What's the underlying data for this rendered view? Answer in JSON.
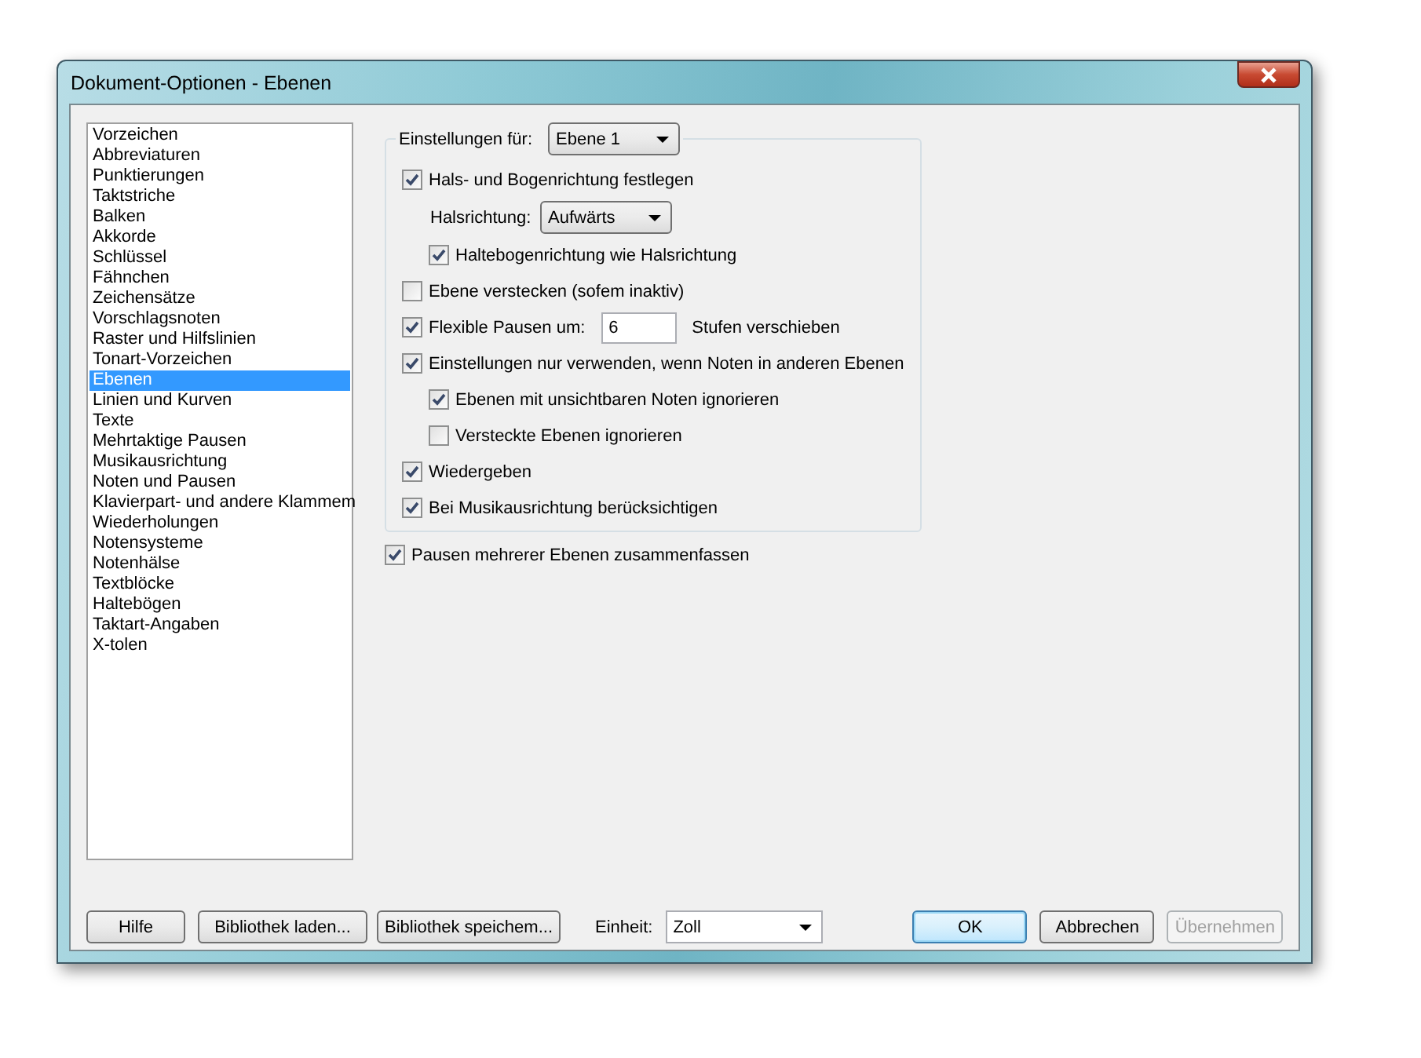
{
  "window": {
    "title": "Dokument-Optionen - Ebenen"
  },
  "categories": [
    {
      "label": "Vorzeichen",
      "selected": false
    },
    {
      "label": "Abbreviaturen",
      "selected": false
    },
    {
      "label": "Punktierungen",
      "selected": false
    },
    {
      "label": "Taktstriche",
      "selected": false
    },
    {
      "label": "Balken",
      "selected": false
    },
    {
      "label": "Akkorde",
      "selected": false
    },
    {
      "label": "Schlüssel",
      "selected": false
    },
    {
      "label": "Fähnchen",
      "selected": false
    },
    {
      "label": "Zeichensätze",
      "selected": false
    },
    {
      "label": "Vorschlagsnoten",
      "selected": false
    },
    {
      "label": "Raster und Hilfslinien",
      "selected": false
    },
    {
      "label": "Tonart-Vorzeichen",
      "selected": false
    },
    {
      "label": "Ebenen",
      "selected": true
    },
    {
      "label": "Linien und Kurven",
      "selected": false
    },
    {
      "label": "Texte",
      "selected": false
    },
    {
      "label": "Mehrtaktige Pausen",
      "selected": false
    },
    {
      "label": "Musikausrichtung",
      "selected": false
    },
    {
      "label": "Noten und Pausen",
      "selected": false
    },
    {
      "label": "Klavierpart- und andere Klammem",
      "selected": false
    },
    {
      "label": "Wiederholungen",
      "selected": false
    },
    {
      "label": "Notensysteme",
      "selected": false
    },
    {
      "label": "Notenhälse",
      "selected": false
    },
    {
      "label": "Textblöcke",
      "selected": false
    },
    {
      "label": "Haltebögen",
      "selected": false
    },
    {
      "label": "Taktart-Angaben",
      "selected": false
    },
    {
      "label": "X-tolen",
      "selected": false
    }
  ],
  "settings_for": {
    "label": "Einstellungen für:",
    "value": "Ebene 1"
  },
  "options": [
    {
      "kind": "checkbox",
      "label": "Hals- und Bogenrichtung festlegen",
      "checked": true,
      "children": [
        {
          "kind": "dropdown",
          "label": "Halsrichtung:",
          "value": "Aufwärts"
        },
        {
          "kind": "checkbox",
          "label": "Haltebogenrichtung wie Halsrichtung",
          "checked": true
        }
      ]
    },
    {
      "kind": "checkbox",
      "label": "Ebene verstecken (sofem inaktiv)",
      "checked": false
    },
    {
      "kind": "checkbox-field",
      "label": "Flexible Pausen um:",
      "checked": true,
      "value": "6",
      "suffix": "Stufen verschieben"
    },
    {
      "kind": "checkbox",
      "label": "Einstellungen nur verwenden, wenn Noten in anderen Ebenen",
      "checked": true,
      "children": [
        {
          "kind": "checkbox",
          "label": "Ebenen mit unsichtbaren Noten ignorieren",
          "checked": true
        },
        {
          "kind": "checkbox",
          "label": "Versteckte Ebenen ignorieren",
          "checked": false
        }
      ]
    },
    {
      "kind": "checkbox",
      "label": "Wiedergeben",
      "checked": true
    },
    {
      "kind": "checkbox",
      "label": "Bei Musikausrichtung berücksichtigen",
      "checked": true
    }
  ],
  "merge_rests": {
    "label": "Pausen mehrerer Ebenen zusammenfassen",
    "checked": true
  },
  "left_buttons": [
    {
      "label": "Hilfe",
      "disabled": false
    },
    {
      "label": "Bibliothek laden...",
      "disabled": false
    },
    {
      "label": "Bibliothek speichem...",
      "disabled": false
    }
  ],
  "unit": {
    "label": "Einheit:",
    "value": "Zoll"
  },
  "right_buttons": [
    {
      "label": "OK",
      "disabled": false,
      "default": true
    },
    {
      "label": "Abbrechen",
      "disabled": false,
      "default": false
    },
    {
      "label": "Übernehmen",
      "disabled": true,
      "default": false
    }
  ]
}
